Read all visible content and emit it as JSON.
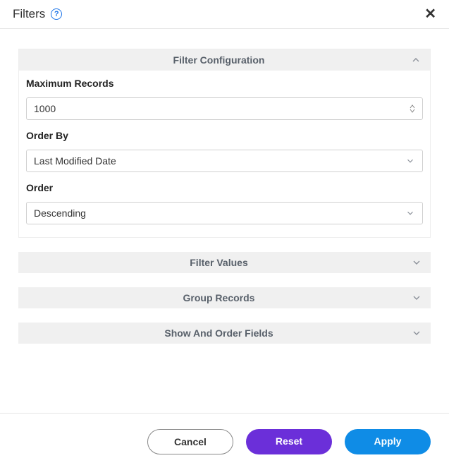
{
  "header": {
    "title": "Filters"
  },
  "sections": {
    "filterConfig": {
      "title": "Filter Configuration",
      "fields": {
        "maxRecords": {
          "label": "Maximum Records",
          "value": "1000"
        },
        "orderBy": {
          "label": "Order By",
          "value": "Last Modified Date"
        },
        "order": {
          "label": "Order",
          "value": "Descending"
        }
      }
    },
    "filterValues": {
      "title": "Filter Values"
    },
    "groupRecords": {
      "title": "Group Records"
    },
    "showAndOrder": {
      "title": "Show And Order Fields"
    }
  },
  "footer": {
    "cancel": "Cancel",
    "reset": "Reset",
    "apply": "Apply"
  }
}
